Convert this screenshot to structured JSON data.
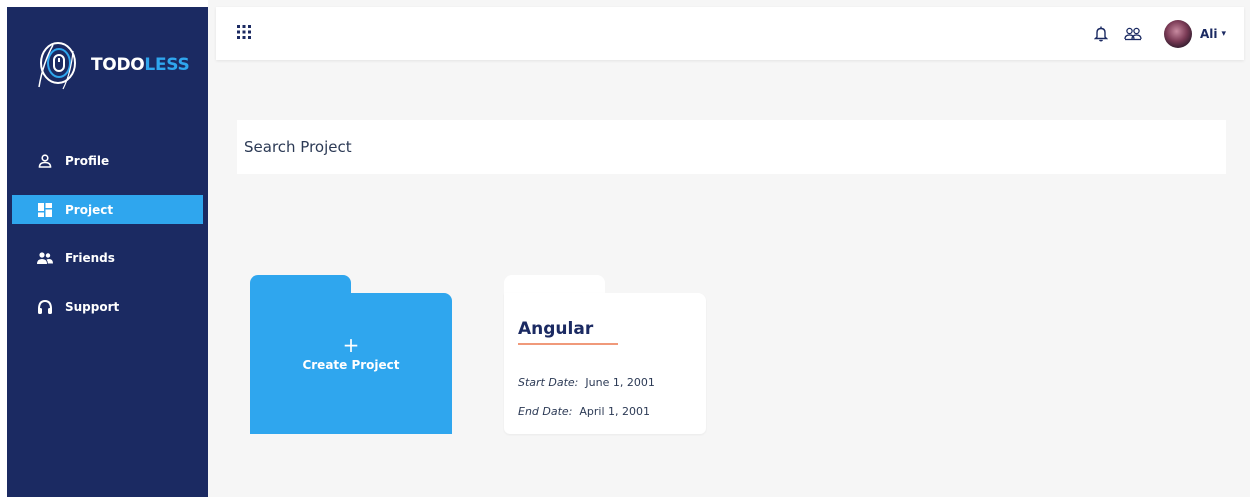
{
  "brand": {
    "name_main": "TODO",
    "name_accent": "LESS",
    "accent_color": "#2fa6ee",
    "sidebar_color": "#1b2a62"
  },
  "sidebar": {
    "items": [
      {
        "label": "Profile",
        "icon": "user-icon",
        "active": false
      },
      {
        "label": "Project",
        "icon": "dashboard-icon",
        "active": true
      },
      {
        "label": "Friends",
        "icon": "users-icon",
        "active": false
      },
      {
        "label": "Support",
        "icon": "headphones-icon",
        "active": false
      }
    ]
  },
  "topbar": {
    "apps_icon": "apps-grid-icon",
    "notification_icon": "bell-icon",
    "people_icon": "people-icon",
    "user_name": "Ali",
    "caret": "▾"
  },
  "search": {
    "label": "Search Project"
  },
  "create": {
    "plus": "+",
    "label": "Create Project"
  },
  "projects": [
    {
      "title": "Angular",
      "start_label": "Start Date:",
      "start_value": "June 1, 2001",
      "end_label": "End Date:",
      "end_value": "April 1, 2001"
    }
  ]
}
